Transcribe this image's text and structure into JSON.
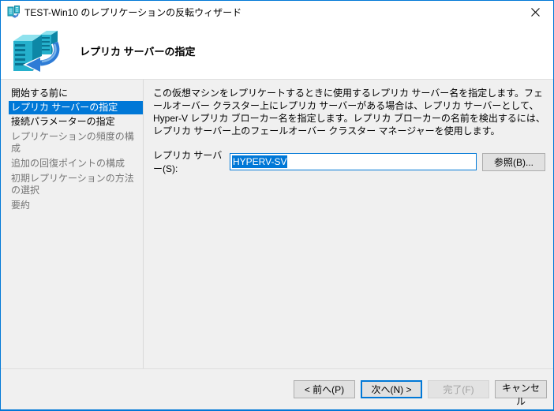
{
  "window": {
    "title": "TEST-Win10 のレプリケーションの反転ウィザード"
  },
  "header": {
    "title": "レプリカ サーバーの指定"
  },
  "sidebar": {
    "items": [
      {
        "label": "開始する前に",
        "state": "enabled"
      },
      {
        "label": "レプリカ サーバーの指定",
        "state": "selected"
      },
      {
        "label": "接続パラメーターの指定",
        "state": "enabled"
      },
      {
        "label": "レプリケーションの頻度の構成",
        "state": "disabled"
      },
      {
        "label": "追加の回復ポイントの構成",
        "state": "disabled"
      },
      {
        "label": "初期レプリケーションの方法の選択",
        "state": "disabled"
      },
      {
        "label": "要約",
        "state": "disabled"
      }
    ]
  },
  "content": {
    "description": "この仮想マシンをレプリケートするときに使用するレプリカ サーバー名を指定します。フェールオーバー クラスター上にレプリカ サーバーがある場合は、レプリカ サーバーとして、Hyper-V レプリカ ブローカー名を指定します。レプリカ ブローカーの名前を検出するには、レプリカ サーバー上のフェールオーバー クラスター マネージャーを使用します。",
    "replica_server_label": "レプリカ サーバー(S):",
    "replica_server_value": "HYPERV-SV",
    "browse_button": "参照(B)..."
  },
  "buttons": {
    "back": "< 前へ(P)",
    "next": "次へ(N) >",
    "finish": "完了(F)",
    "cancel": "キャンセル"
  },
  "colors": {
    "accent": "#0078d7",
    "window_background": "#f0f0f0",
    "header_background": "#ffffff",
    "selected_item_background": "#0078d7",
    "icon_teal": "#25b0cc"
  }
}
